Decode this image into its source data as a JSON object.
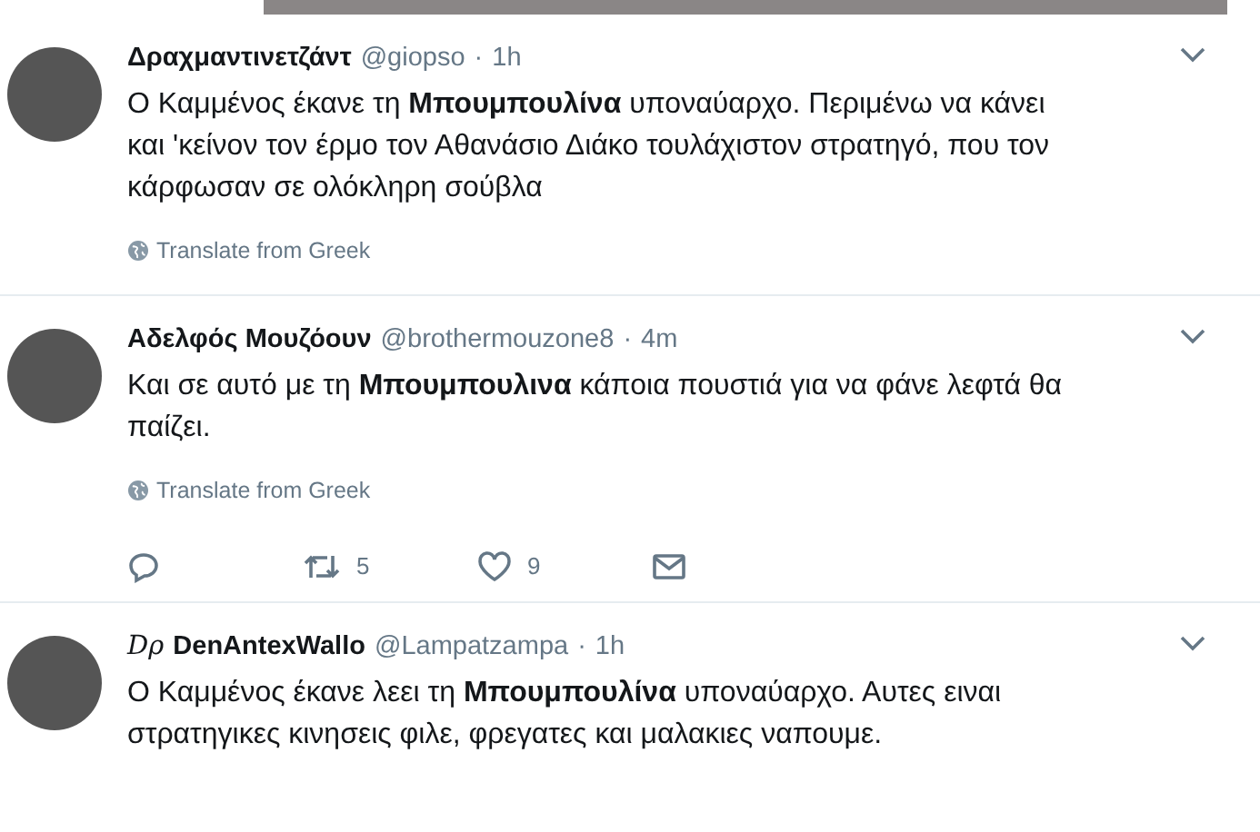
{
  "embedded_image": {
    "kind": "photo"
  },
  "tweets": [
    {
      "name": "Δραχμαντινετζάντ",
      "handle": "@giopso",
      "separator": "·",
      "time": "1h",
      "text": "Ο Καμμένος έκανε τη **Μπουμπουλίνα** υποναύαρχο. Περιμένω να κάνει και 'κείνον τον έρμο τον Αθανάσιο Διάκο τουλάχιστον στρατηγό, που τον κάρφωσαν σε ολόκληρη σούβλα",
      "translate": "Translate from Greek"
    },
    {
      "name": "Αδελφός Μουζόουν",
      "handle": "@brothermouzone8",
      "separator": "·",
      "time": "4m",
      "text": "Και σε αυτό με τη **Μπουμπουλινα** κάποια πουστιά για να φάνε λεφτά θα παίζει.",
      "translate": "Translate from Greek",
      "actions": [
        {
          "kind": "reply"
        },
        {
          "kind": "retweet",
          "count": "5"
        },
        {
          "kind": "like",
          "count": "9"
        },
        {
          "kind": "message"
        }
      ]
    },
    {
      "name_prefix": "Dρ",
      "name": "DenAntexWallo",
      "handle": "@Lampatzampa",
      "separator": "·",
      "time": "1h",
      "text": "Ο Καμμένος έκανε λεει τη **Μπουμπουλίνα** υποναύαρχο. Αυτες ειναι στρατηγικες κινησεις φιλε, φρεγατες και μαλακιες ναπουμε."
    }
  ]
}
